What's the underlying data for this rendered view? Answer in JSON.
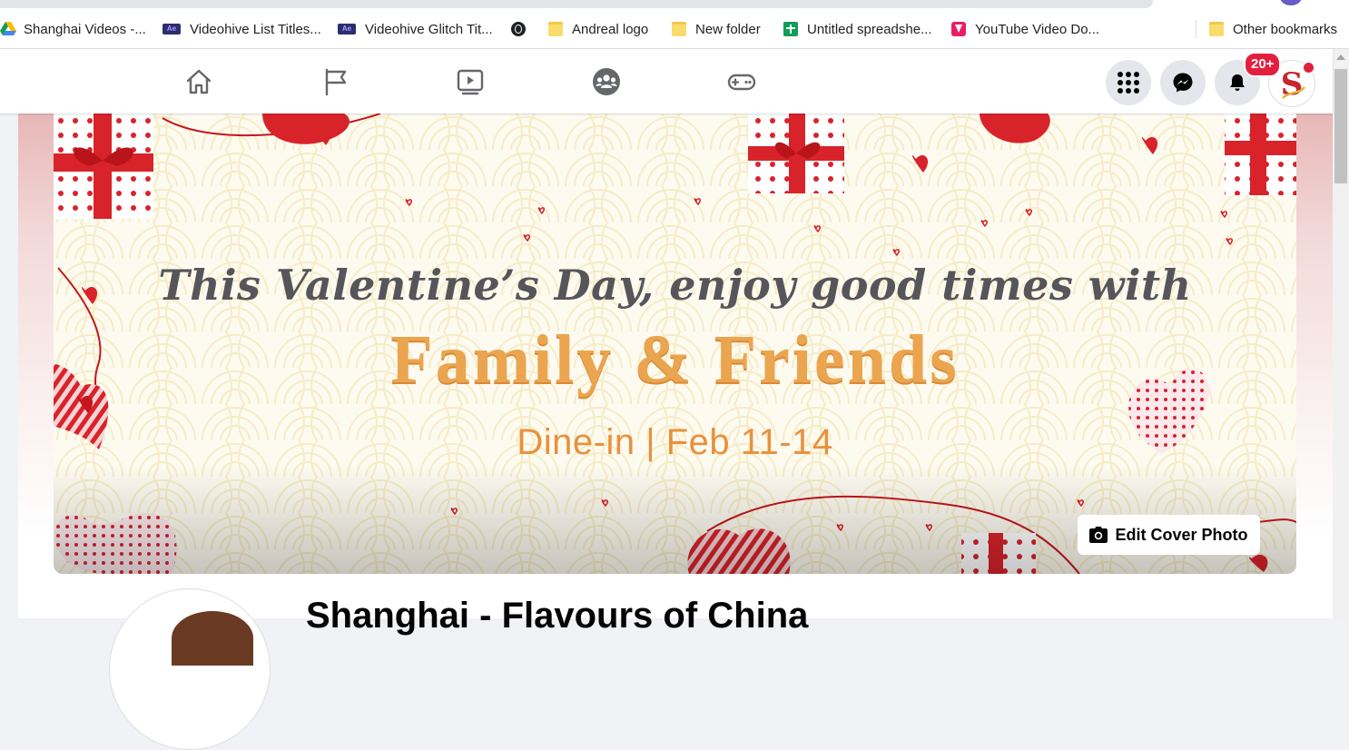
{
  "bookmarks": {
    "items": [
      {
        "label": "Shanghai Videos -...",
        "icon": "google-drive-icon"
      },
      {
        "label": "Videohive List Titles...",
        "icon": "after-effects-icon"
      },
      {
        "label": "Videohive Glitch Tit...",
        "icon": "after-effects-icon"
      },
      {
        "label": "",
        "icon": "globe-icon"
      },
      {
        "label": "Andreal logo",
        "icon": "folder-icon"
      },
      {
        "label": "New folder",
        "icon": "folder-icon"
      },
      {
        "label": "Untitled spreadshe...",
        "icon": "sheets-icon"
      },
      {
        "label": "YouTube Video Do...",
        "icon": "download-icon"
      }
    ],
    "other": "Other bookmarks",
    "ae_glyph": "Ae"
  },
  "nav": {
    "tabs": [
      "home-icon",
      "flag-icon",
      "video-icon",
      "groups-icon",
      "gaming-icon"
    ],
    "menu_icon": "grid-menu-icon",
    "messenger_icon": "messenger-icon",
    "notifications_icon": "bell-icon",
    "notification_badge": "20+",
    "avatar_letter": "S"
  },
  "cover": {
    "line1": "This Valentine’s Day, enjoy good times with",
    "line2": "Family & Friends",
    "line3": "Dine-in | Feb 11-14",
    "edit_button": "Edit Cover Photo"
  },
  "page": {
    "title": "Shanghai - Flavours of China"
  },
  "colors": {
    "brand_blue": "#1877f2",
    "badge_red": "#e41e3f",
    "cover_orange": "#eba54f",
    "heart_red": "#d8232a"
  }
}
